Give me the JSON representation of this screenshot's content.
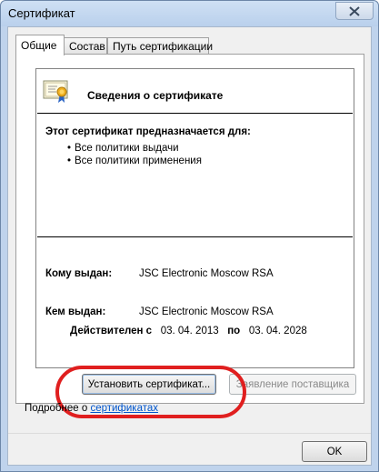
{
  "window": {
    "title": "Сертификат",
    "close_glyph": "close-icon"
  },
  "tabs": [
    {
      "label": "Общие",
      "active": true
    },
    {
      "label": "Состав",
      "active": false
    },
    {
      "label": "Путь сертификации",
      "active": false
    }
  ],
  "info": {
    "title": "Сведения о сертификате",
    "purpose_heading": "Этот сертификат предназначается для:",
    "purposes": [
      "Все политики выдачи",
      "Все политики применения"
    ],
    "issued_to_label": "Кому выдан:",
    "issued_to_value": "JSC Electronic Moscow RSA",
    "issued_by_label": "Кем выдан:",
    "issued_by_value": "JSC Electronic Moscow RSA",
    "valid_from_label": "Действителен с",
    "valid_from": "03. 04. 2013",
    "valid_to_label": "по",
    "valid_to": "03. 04. 2028"
  },
  "buttons": {
    "install": "Установить сертификат...",
    "issuer_statement": "Заявление поставщика",
    "ok": "OK"
  },
  "more": {
    "prefix": "Подробнее о",
    "link": "сертификатах"
  },
  "colors": {
    "highlight": "#e01f1f",
    "link": "#0055cc",
    "title_bar": "#bfd3ec"
  }
}
